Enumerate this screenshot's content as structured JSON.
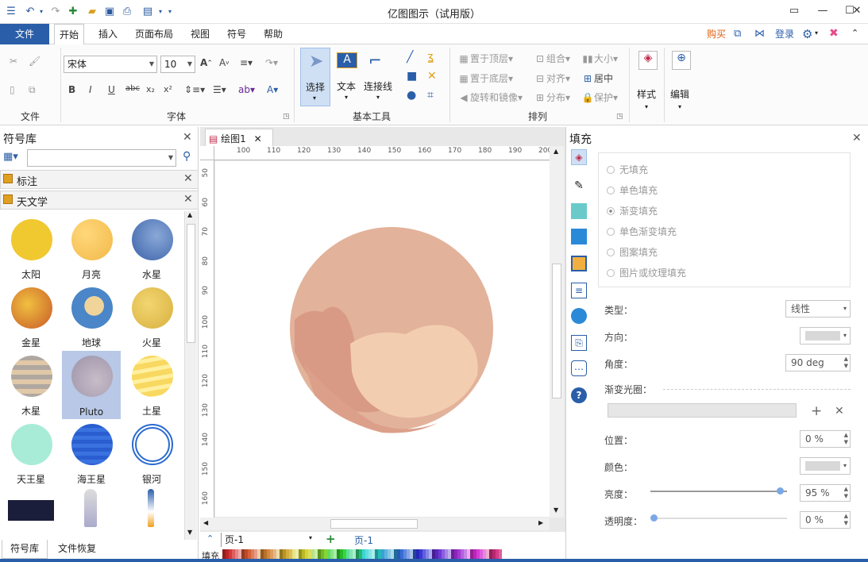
{
  "app": {
    "title": "亿图图示（试用版）"
  },
  "menu": {
    "file": "文件",
    "tabs": [
      "开始",
      "插入",
      "页面布局",
      "视图",
      "符号",
      "帮助"
    ],
    "right": {
      "buy": "购买",
      "login": "登录"
    }
  },
  "ribbon": {
    "groups": {
      "file": "文件",
      "font": "字体",
      "basic_tools": "基本工具",
      "arrange": "排列"
    },
    "font": {
      "family": "宋体",
      "size": "10"
    },
    "tools": {
      "select": "选择",
      "text": "文本",
      "connector": "连接线"
    },
    "arrange": {
      "bring_front": "置于顶层",
      "send_back": "置于底层",
      "rotate_mirror": "旋转和镜像",
      "group": "组合",
      "align": "对齐",
      "distribute": "分布",
      "size": "大小",
      "center": "居中",
      "protect": "保护"
    },
    "style": "样式",
    "edit": "编辑"
  },
  "left_panel": {
    "title": "符号库",
    "libraries": [
      "标注",
      "天文学"
    ],
    "symbols": [
      {
        "label": "太阳"
      },
      {
        "label": "月亮"
      },
      {
        "label": "水星"
      },
      {
        "label": "金星"
      },
      {
        "label": "地球"
      },
      {
        "label": "火星"
      },
      {
        "label": "木星"
      },
      {
        "label": "Pluto"
      },
      {
        "label": "土星"
      },
      {
        "label": "天王星"
      },
      {
        "label": "海王星"
      },
      {
        "label": "银河"
      }
    ],
    "bottom_tabs": [
      "符号库",
      "文件恢复"
    ]
  },
  "canvas": {
    "doc_tab": "绘图1",
    "ruler_h": [
      "100",
      "110",
      "120",
      "130",
      "140",
      "150",
      "160",
      "170",
      "180",
      "190",
      "200"
    ],
    "ruler_v": [
      "50",
      "60",
      "70",
      "80",
      "90",
      "100",
      "110",
      "120",
      "130",
      "140",
      "150",
      "160"
    ],
    "page_selector": "页-1",
    "page_tab": "页-1",
    "fill_label": "填充"
  },
  "right_panel": {
    "title": "填充",
    "fill_options": [
      "无填充",
      "单色填充",
      "渐变填充",
      "单色渐变填充",
      "图案填充",
      "图片或纹理填充"
    ],
    "selected_fill": "渐变填充",
    "props": {
      "type_label": "类型：",
      "type_value": "线性",
      "direction_label": "方向：",
      "angle_label": "角度：",
      "angle_value": "90 deg",
      "gradient_label": "渐变光圈：",
      "position_label": "位置：",
      "position_value": "0 %",
      "color_label": "颜色：",
      "brightness_label": "亮度：",
      "brightness_value": "95 %",
      "transparency_label": "透明度：",
      "transparency_value": "0 %"
    },
    "brightness_fraction": 0.95,
    "transparency_fraction": 0.0
  },
  "colors": {
    "accent": "#2a5ea8",
    "pluto": "#e2b29a"
  }
}
